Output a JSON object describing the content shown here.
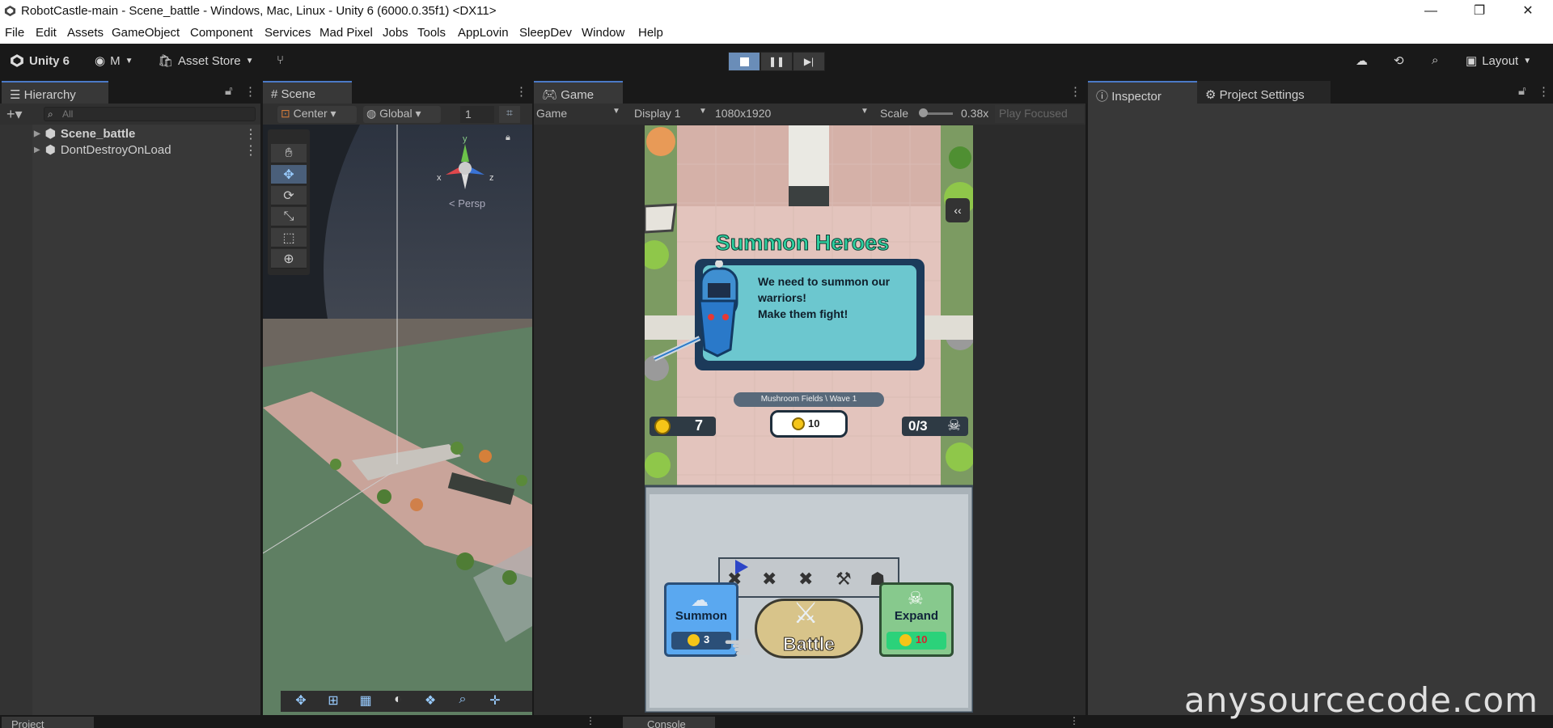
{
  "window": {
    "title": "RobotCastle-main - Scene_battle - Windows, Mac, Linux - Unity 6 (6000.0.35f1) <DX11>",
    "controls": [
      "minimize",
      "restore",
      "close"
    ]
  },
  "menu": [
    "File",
    "Edit",
    "Assets",
    "GameObject",
    "Component",
    "Services",
    "Mad Pixel",
    "Jobs",
    "Tools",
    "AppLovin",
    "SleepDev",
    "Window",
    "Help"
  ],
  "toolbar": {
    "unity_label": "Unity 6",
    "account_label": "M",
    "asset_store_label": "Asset Store",
    "layout_label": "Layout"
  },
  "hierarchy": {
    "tab": "Hierarchy",
    "search_placeholder": "All",
    "items": [
      "Scene_battle",
      "DontDestroyOnLoad"
    ]
  },
  "scene": {
    "tab": "Scene",
    "pivot": "Center",
    "space": "Global",
    "grid_value": "1",
    "gizmo_y": "y",
    "gizmo_x": "x",
    "gizmo_z": "z",
    "persp": "< Persp"
  },
  "game": {
    "tab": "Game",
    "mode": "Game",
    "display": "Display 1",
    "resolution": "1080x1920",
    "scale_label": "Scale",
    "scale_value": "0.38x",
    "play_focused": "Play Focused",
    "summon_title": "Summon Heroes",
    "dialog_text_1": "We need to summon our",
    "dialog_text_2": "warriors!",
    "dialog_text_3": "Make them fight!",
    "wave_label": "Mushroom Fields \\ Wave 1",
    "coins": "7",
    "bubble_coins": "10",
    "kills": "0/3",
    "summon_label": "Summon",
    "summon_cost": "3",
    "battle_label": "Battle",
    "expand_label": "Expand",
    "expand_cost": "10"
  },
  "inspector": {
    "tab": "Inspector",
    "project_settings_tab": "Project Settings"
  },
  "bottom": {
    "project_tab": "Project",
    "console_tab": "Console"
  },
  "watermark": "anysourcecode.com"
}
